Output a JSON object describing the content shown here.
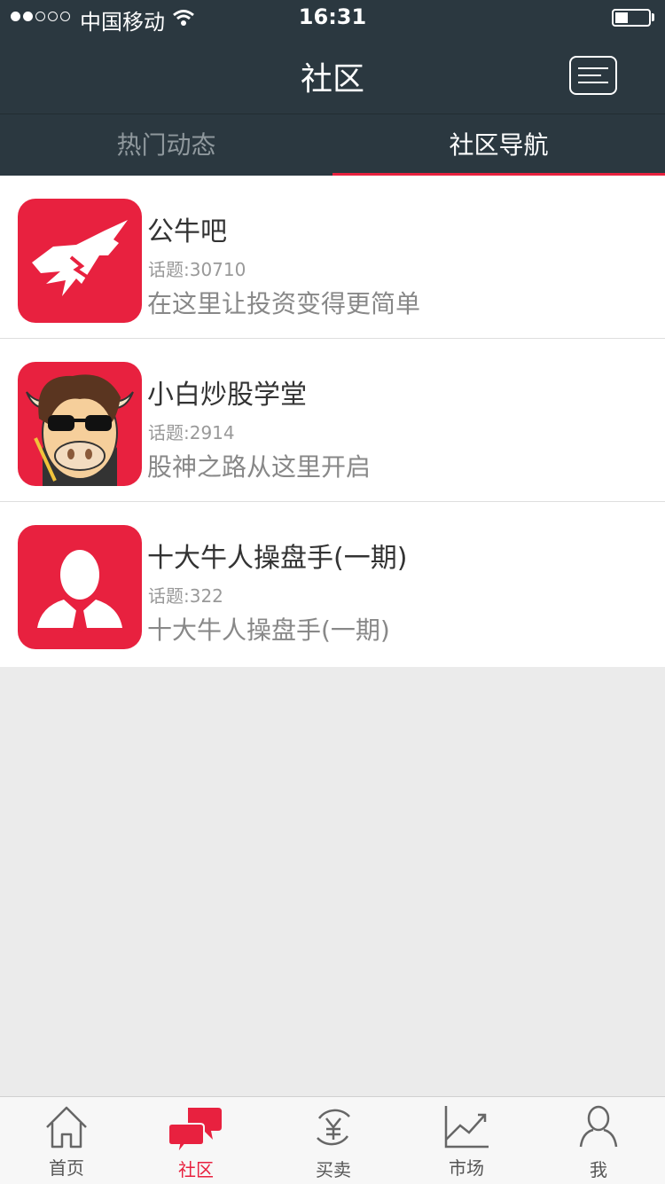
{
  "status_bar": {
    "carrier": "中国移动",
    "time": "16:31",
    "battery_level": 0.4
  },
  "header": {
    "title": "社区"
  },
  "tabs": [
    {
      "label": "热门动态",
      "active": false
    },
    {
      "label": "社区导航",
      "active": true
    }
  ],
  "communities": [
    {
      "name": "公牛吧",
      "topic_count": "话题:30710",
      "description": "在这里让投资变得更简单",
      "icon": "bull-logo-icon"
    },
    {
      "name": "小白炒股学堂",
      "topic_count": "话题:2914",
      "description": "股神之路从这里开启",
      "icon": "cartoon-bull-teacher-icon"
    },
    {
      "name": "十大牛人操盘手(一期)",
      "topic_count": "话题:322",
      "description": "十大牛人操盘手(一期)",
      "icon": "person-silhouette-icon"
    }
  ],
  "bottom_nav": [
    {
      "label": "首页",
      "icon": "home-icon",
      "active": false
    },
    {
      "label": "社区",
      "icon": "chat-bubbles-icon",
      "active": true
    },
    {
      "label": "买卖",
      "icon": "yuan-exchange-icon",
      "active": false
    },
    {
      "label": "市场",
      "icon": "chart-icon",
      "active": false
    },
    {
      "label": "我",
      "icon": "user-icon",
      "active": false
    }
  ],
  "colors": {
    "header_bg": "#2b3840",
    "accent": "#e8213f",
    "page_bg": "#ebebeb"
  }
}
